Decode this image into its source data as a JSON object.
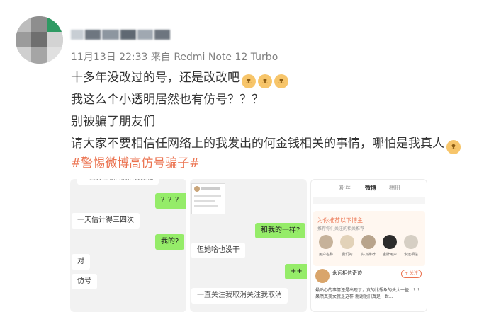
{
  "post": {
    "meta": "11月13日 22:33  来自 Redmi Note 12 Turbo",
    "lines": [
      "十多年没改过的号，还是改改吧",
      "我这么个小透明居然也有仿号？？？",
      "别被骗了朋友们",
      "请大家不要相信任网络上的我发出的何金钱相关的事情，哪怕是我真人"
    ],
    "hashtag": "#警惕微博高仿号骗子#"
  },
  "emoji": {
    "cat_icon": "cat-doge-emoji"
  },
  "colors": {
    "hashtag": "#eb7350",
    "chat_green": "#95ec69",
    "meta": "#808080"
  },
  "thumb1": {
    "top_cut": "一直关注我再取消关注我",
    "q": "？？？",
    "m1": "一天估计得三四次",
    "me": "我的?",
    "m2": "对",
    "m3": "仿号"
  },
  "thumb2": {
    "m1": "和我的一样?",
    "m2": "但她啥也没干",
    "m3": "++",
    "m4": "一直关注我取消关注我取消"
  },
  "thumb3": {
    "tabs": [
      "粉丝",
      "微博",
      "相册"
    ],
    "rec_title": "为你推荐以下博主",
    "rec_sub": "推荐你们关注的相关推荐",
    "rec_names": [
      "用户名称",
      "我们的",
      "好友推荐",
      "金牌用户",
      "永远相信"
    ],
    "post_name": "永远相信奇迹",
    "follow": "+ 关注",
    "post_text": "最贴心的事情还是出现了，真的比想象的头大一些...！！果然真美女就是这样 谢谢他们真是一世..."
  }
}
